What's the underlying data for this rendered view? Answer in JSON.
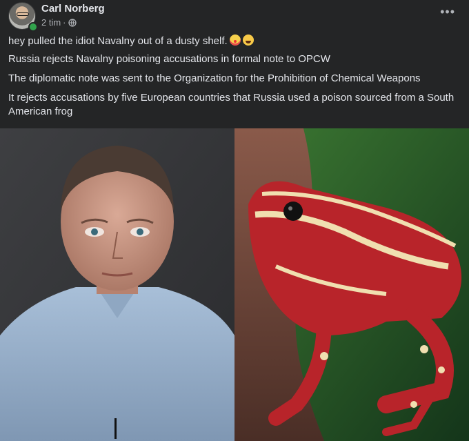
{
  "post": {
    "author": "Carl Norberg",
    "time": "2 tim",
    "separator": "·",
    "privacy_icon": "globe-icon",
    "more_icon": "more-options-icon",
    "lines": [
      "hey pulled the idiot Navalny out of a dusty shelf.",
      "Russia rejects Navalny poisoning accusations in formal note to OPCW",
      "The diplomatic note was sent to the Organization for the Prohibition of Chemical Weapons",
      "It rejects accusations by five European countries that Russia used a poison sourced from a South American frog"
    ],
    "emojis": [
      "clown-face",
      "laughing-face"
    ]
  },
  "colors": {
    "background": "#242526",
    "text": "#e4e6eb",
    "secondary_text": "#b0b3b8",
    "online": "#31a24c"
  }
}
